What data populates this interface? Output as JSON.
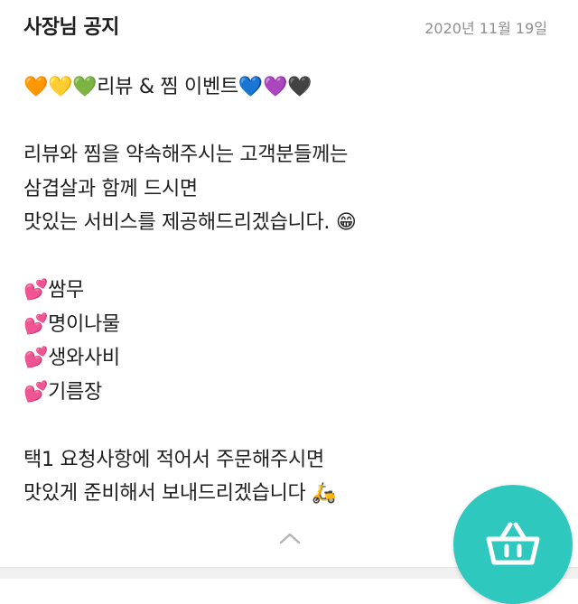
{
  "header": {
    "title": "사장님 공지",
    "date": "2020년 11월 19일"
  },
  "notice": {
    "lines": [
      "🧡💛💚리뷰 & 찜 이벤트💙💜🖤",
      "",
      "리뷰와 찜을 약속해주시는 고객분들께는",
      "삼겹살과 함께 드시면",
      "맛있는 서비스를 제공해드리겠습니다. 😁",
      "",
      "💕쌈무",
      "💕명이나물",
      "💕생와사비",
      "💕기름장",
      "",
      "택1  요청사항에 적어서 주문해주시면",
      "맛있게 준비해서 보내드리겠습니다 🛵"
    ]
  },
  "icons": {
    "scroll": "chevron-up-icon",
    "cart": "shopping-basket-icon"
  },
  "colors": {
    "accent": "#2ec8bf",
    "date": "#8f8f8f",
    "text": "#1f1f1f"
  }
}
